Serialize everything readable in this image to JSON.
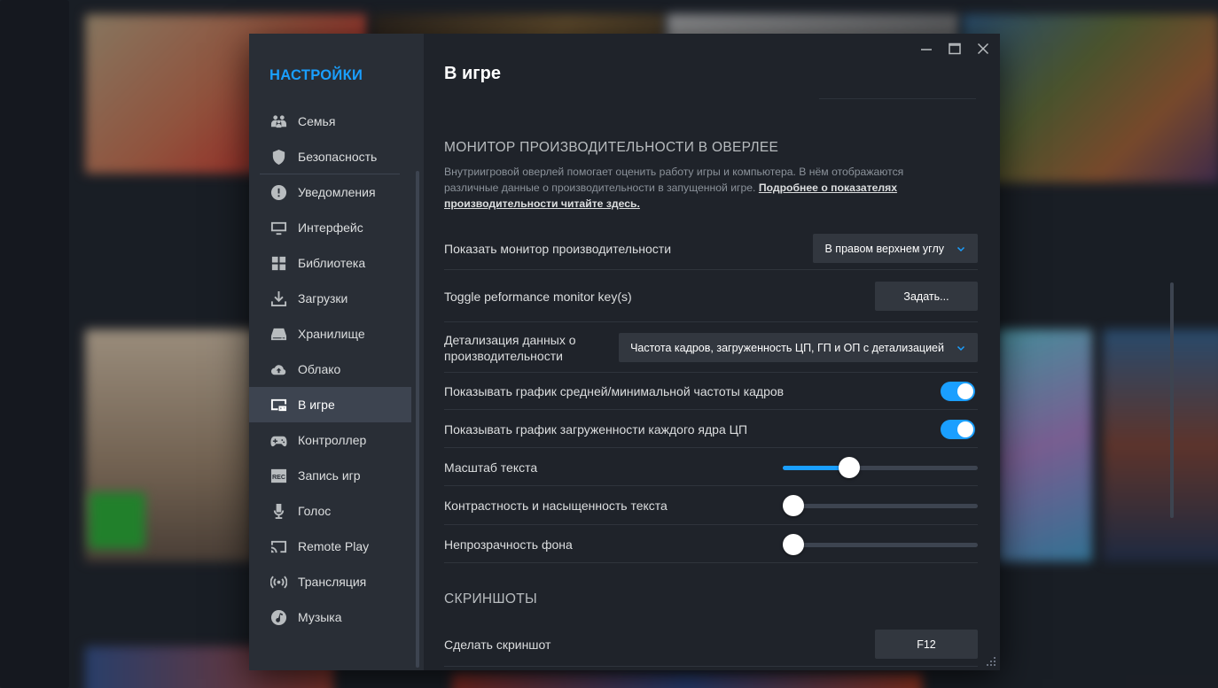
{
  "window": {
    "minimize_icon": "minimize-icon",
    "maximize_icon": "maximize-icon",
    "close_icon": "close-icon"
  },
  "sidebar": {
    "title": "НАСТРОЙКИ",
    "items": [
      {
        "label": "Семья",
        "icon": "family-icon"
      },
      {
        "label": "Безопасность",
        "icon": "shield-icon"
      },
      {
        "label": "Уведомления",
        "icon": "alert-icon"
      },
      {
        "label": "Интерфейс",
        "icon": "monitor-icon"
      },
      {
        "label": "Библиотека",
        "icon": "grid-icon"
      },
      {
        "label": "Загрузки",
        "icon": "download-icon"
      },
      {
        "label": "Хранилище",
        "icon": "drive-icon"
      },
      {
        "label": "Облако",
        "icon": "cloud-icon"
      },
      {
        "label": "В игре",
        "icon": "in-game-icon",
        "active": true
      },
      {
        "label": "Контроллер",
        "icon": "gamepad-icon"
      },
      {
        "label": "Запись игр",
        "icon": "rec-icon"
      },
      {
        "label": "Голос",
        "icon": "microphone-icon"
      },
      {
        "label": "Remote Play",
        "icon": "cast-icon"
      },
      {
        "label": "Трансляция",
        "icon": "broadcast-icon"
      },
      {
        "label": "Музыка",
        "icon": "music-icon"
      }
    ]
  },
  "main": {
    "title": "В игре",
    "perf_section": {
      "heading": "МОНИТОР ПРОИЗВОДИТЕЛЬНОСТИ В ОВЕРЛЕЕ",
      "description": "Внутриигровой оверлей помогает оценить работу игры и компьютера. В нём отображаются различные данные о производительности в запущенной игре.",
      "link": "Подробнее о показателях производительности читайте здесь."
    },
    "settings": {
      "show_monitor": {
        "label": "Показать монитор производительности",
        "value": "В правом верхнем углу"
      },
      "toggle_key": {
        "label": "Toggle peformance monitor key(s)",
        "button": "Задать..."
      },
      "detail": {
        "label": "Детализация данных о производительности",
        "value": "Частота кадров, загруженность ЦП, ГП и ОП с детализацией"
      },
      "avg_min_fps_graph": {
        "label": "Показывать график средней/минимальной частоты кадров",
        "on": true
      },
      "cpu_core_graph": {
        "label": "Показывать график загруженности каждого ядра ЦП",
        "on": true
      },
      "text_scale": {
        "label": "Масштаб текста",
        "value": 0.32
      },
      "text_contrast": {
        "label": "Контрастность и насыщенность текста",
        "value": 0
      },
      "bg_opacity": {
        "label": "Непрозрачность фона",
        "value": 0
      }
    },
    "screenshots_section": {
      "heading": "СКРИНШОТЫ",
      "take_screenshot": {
        "label": "Сделать скриншот",
        "key": "F12"
      }
    }
  },
  "colors": {
    "accent": "#1a9fff",
    "sidebar_bg": "#292e36",
    "main_bg": "#1f232a"
  }
}
